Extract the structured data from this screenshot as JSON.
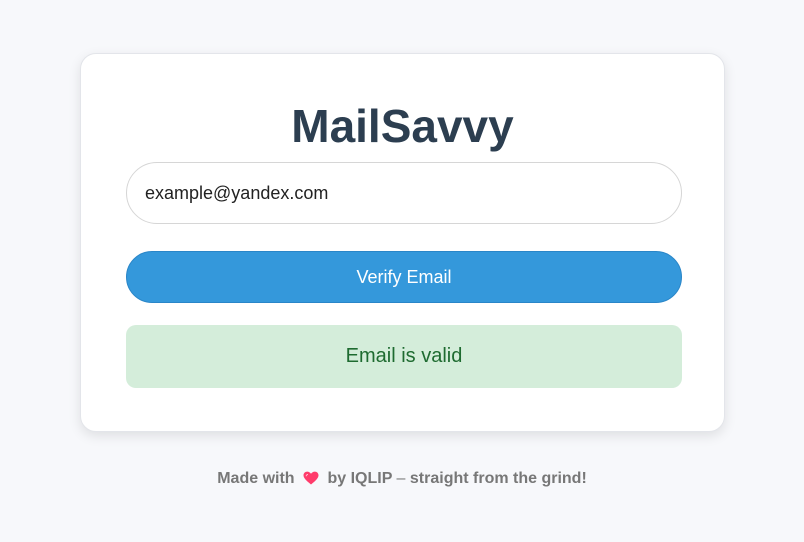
{
  "app": {
    "title": "MailSavvy"
  },
  "form": {
    "email_value": "example@yandex.com",
    "verify_label": "Verify Email"
  },
  "result": {
    "message": "Email is valid",
    "status": "valid",
    "colors": {
      "background": "#d4edda",
      "text": "#1e6b30"
    }
  },
  "footer": {
    "prefix": "Made with",
    "icon": "heart-icon",
    "middle": "by IQLIP",
    "dash": "–",
    "suffix": "straight from the grind!"
  },
  "colors": {
    "accent": "#3498db",
    "title": "#2c3e50",
    "heart": "#ff3b6b"
  }
}
